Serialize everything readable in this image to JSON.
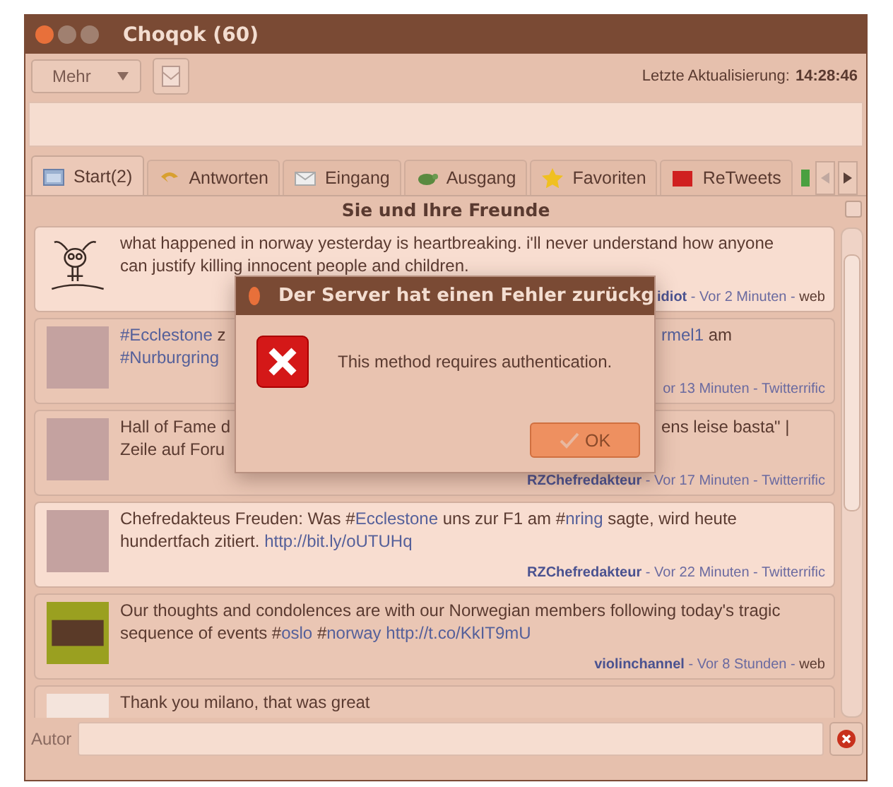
{
  "window": {
    "title": "Choqok (60)"
  },
  "toolbar": {
    "menu_button": "Mehr",
    "last_update_label": "Letzte Aktualisierung:",
    "last_update_time": "14:28:46"
  },
  "tabs": [
    {
      "label": "Start(2)",
      "selected": true
    },
    {
      "label": "Antworten",
      "selected": false
    },
    {
      "label": "Eingang",
      "selected": false
    },
    {
      "label": "Ausgang",
      "selected": false
    },
    {
      "label": "Favoriten",
      "selected": false
    },
    {
      "label": "ReTweets",
      "selected": false
    }
  ],
  "timeline": {
    "title": "Sie und Ihre Freunde",
    "tweets": [
      {
        "kind": "drawing",
        "highlighted": true,
        "lines": [
          [
            {
              "kind": "text",
              "text": "what happened in norway yesterday is heartbreaking. i'll never understand how anyone"
            }
          ],
          [
            {
              "kind": "text",
              "text": "can justify killing innocent people and children."
            }
          ]
        ],
        "meta": [
          {
            "kind": "user",
            "text": "idiot"
          },
          {
            "kind": "sep",
            "text": " - "
          },
          {
            "kind": "time",
            "text": "Vor 2 Minuten"
          },
          {
            "kind": "sep",
            "text": " - "
          },
          {
            "kind": "source",
            "text": "web"
          }
        ]
      },
      {
        "kind": "photo",
        "highlighted": false,
        "lines": [
          [
            {
              "kind": "tag",
              "text": "#Ecclestone"
            },
            {
              "kind": "text",
              "text": " z"
            }
          ],
          [
            {
              "kind": "tag",
              "text": "#Nurburgring"
            }
          ]
        ],
        "right_lines": [
          [
            {
              "kind": "tag",
              "text": "rmel1"
            },
            {
              "kind": "text",
              "text": " am"
            }
          ]
        ],
        "meta": [
          {
            "kind": "time",
            "text": "or 13 Minuten"
          },
          {
            "kind": "sep",
            "text": " - "
          },
          {
            "kind": "time",
            "text": "Twitterrific"
          }
        ]
      },
      {
        "kind": "photo",
        "highlighted": false,
        "lines": [
          [
            {
              "kind": "text",
              "text": "Hall of Fame d"
            }
          ],
          [
            {
              "kind": "text",
              "text": "Zeile auf Foru"
            }
          ]
        ],
        "right_lines": [
          [
            {
              "kind": "text",
              "text": "ens leise basta\" |"
            }
          ]
        ],
        "meta": [
          {
            "kind": "user",
            "text": "RZChefredakteur"
          },
          {
            "kind": "sep",
            "text": " - "
          },
          {
            "kind": "time",
            "text": "Vor 17 Minuten"
          },
          {
            "kind": "sep",
            "text": " - "
          },
          {
            "kind": "time",
            "text": "Twitterrific"
          }
        ]
      },
      {
        "kind": "photo",
        "highlighted": true,
        "lines": [
          [
            {
              "kind": "text",
              "text": "Chefredakteus Freuden: Was #"
            },
            {
              "kind": "tag",
              "text": "Ecclestone"
            },
            {
              "kind": "text",
              "text": " uns zur F1 am #"
            },
            {
              "kind": "tag",
              "text": "nring"
            },
            {
              "kind": "text",
              "text": " sagte, wird heute"
            }
          ],
          [
            {
              "kind": "text",
              "text": "hundertfach zitiert. "
            },
            {
              "kind": "tag",
              "text": "http://bit.ly/oUTUHq"
            }
          ]
        ],
        "meta": [
          {
            "kind": "user",
            "text": "RZChefredakteur"
          },
          {
            "kind": "sep",
            "text": " - "
          },
          {
            "kind": "time",
            "text": "Vor 22 Minuten"
          },
          {
            "kind": "sep",
            "text": " - "
          },
          {
            "kind": "time",
            "text": "Twitterrific"
          }
        ]
      },
      {
        "kind": "logo",
        "highlighted": false,
        "lines": [
          [
            {
              "kind": "text",
              "text": "Our thoughts and condolences are with our Norwegian members following today's tragic"
            }
          ],
          [
            {
              "kind": "text",
              "text": "sequence of events #"
            },
            {
              "kind": "tag",
              "text": "oslo"
            },
            {
              "kind": "text",
              "text": " #"
            },
            {
              "kind": "tag",
              "text": "norway http://t.co/KkIT9mU"
            }
          ]
        ],
        "meta": [
          {
            "kind": "user",
            "text": "violinchannel"
          },
          {
            "kind": "sep",
            "text": " - "
          },
          {
            "kind": "time",
            "text": "Vor 8 Stunden"
          },
          {
            "kind": "sep",
            "text": " - "
          },
          {
            "kind": "source",
            "text": "web"
          }
        ]
      },
      {
        "kind": "blank",
        "highlighted": false,
        "lines": [
          [
            {
              "kind": "text",
              "text": "Thank you milano, that was great"
            }
          ]
        ]
      }
    ]
  },
  "filter": {
    "label": "Autor"
  },
  "dialog": {
    "title": "Der Server hat einen Fehler zurückg",
    "message": "This method requires authentication.",
    "button": "OK"
  }
}
